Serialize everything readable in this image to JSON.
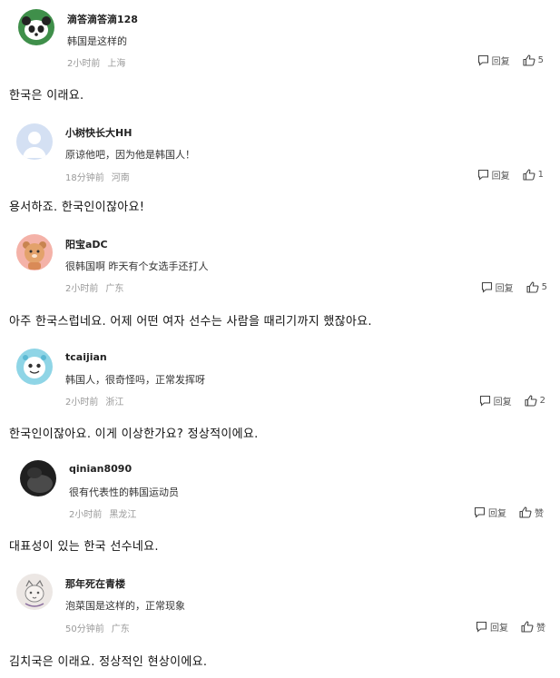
{
  "comments": [
    {
      "username": "滴答滴答滴128",
      "text": "韩国是这样的",
      "time": "2小时前",
      "location": "上海",
      "reply_label": "回复",
      "like_label": "5",
      "translation": "한국은 이래요."
    },
    {
      "username": "小树快长大HH",
      "text": "原谅他吧，因为他是韩国人！",
      "time": "18分钟前",
      "location": "河南",
      "reply_label": "回复",
      "like_label": "1",
      "translation": "용서하죠. 한국인이잖아요!"
    },
    {
      "username": "阳宝aDC",
      "text": "很韩国啊 昨天有个女选手还打人",
      "time": "2小时前",
      "location": "广东",
      "reply_label": "回复",
      "like_label": "5",
      "translation": "아주 한국스럽네요. 어제 어떤 여자 선수는 사람을 때리기까지 했잖아요."
    },
    {
      "username": "tcaijian",
      "text": "韩国人，很奇怪吗，正常发挥呀",
      "time": "2小时前",
      "location": "浙江",
      "reply_label": "回复",
      "like_label": "2",
      "translation": "한국인이잖아요. 이게 이상한가요? 정상적이에요."
    },
    {
      "username": "qinian8090",
      "text": "很有代表性的韩国运动员",
      "time": "2小时前",
      "location": "黑龙江",
      "reply_label": "回复",
      "like_label": "赞",
      "translation": "대표성이 있는 한국 선수네요."
    },
    {
      "username": "那年死在青楼",
      "text": "泡菜国是这样的，正常现象",
      "time": "50分钟前",
      "location": "广东",
      "reply_label": "回复",
      "like_label": "赞",
      "translation": "김치국은 이래요. 정상적인 현상이에요."
    }
  ]
}
